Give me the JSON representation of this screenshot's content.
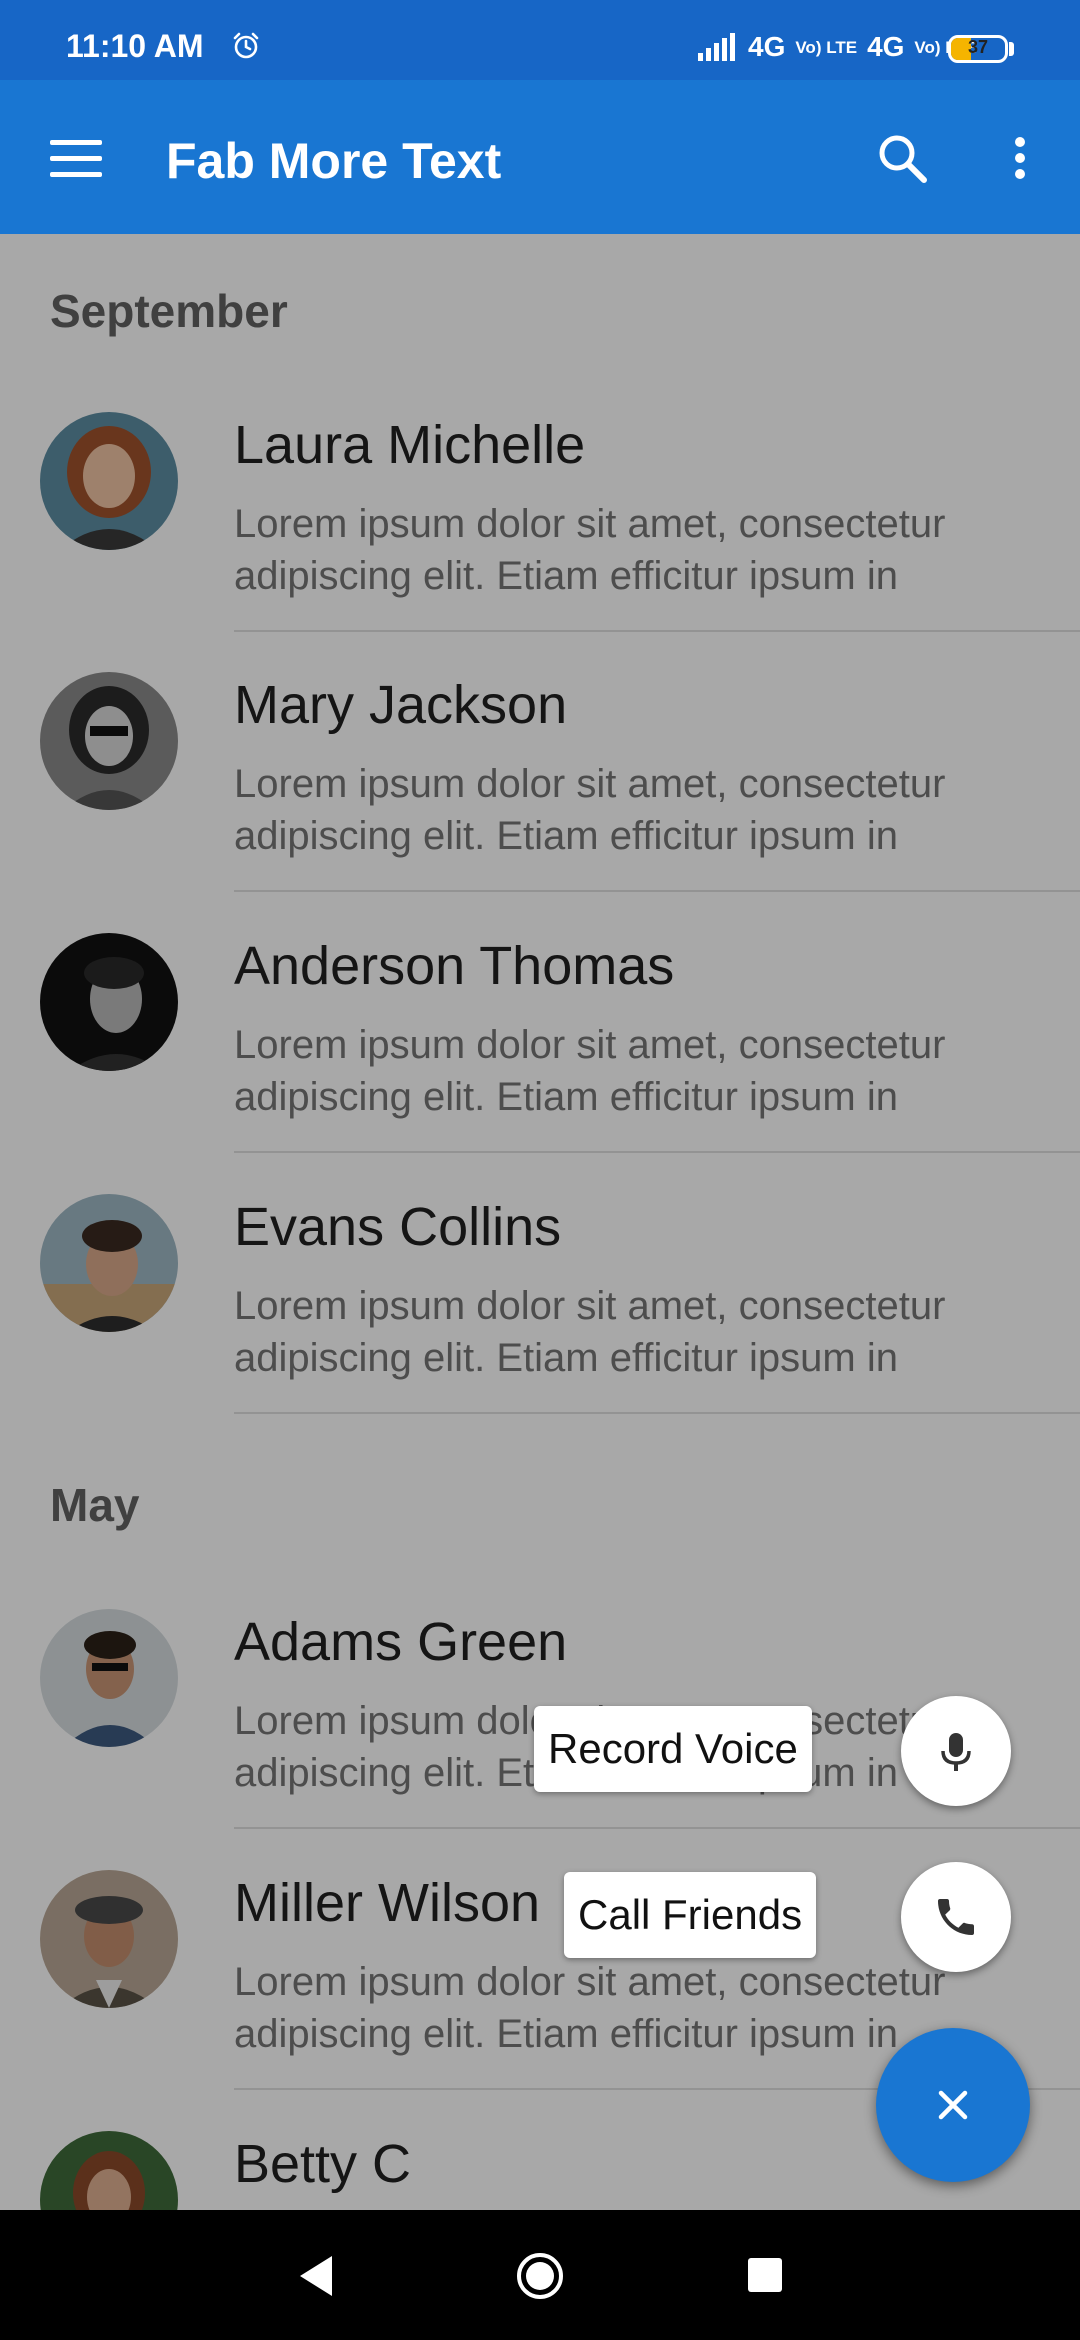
{
  "status_bar": {
    "time": "11:10 AM",
    "network": [
      "4G",
      "4G"
    ],
    "volte_label": "Vo) LTE",
    "battery_level": "37",
    "battery_fraction": 0.37
  },
  "app_bar": {
    "title": "Fab More Text",
    "icons": [
      "menu-icon",
      "search-icon",
      "more-vertical-icon"
    ]
  },
  "sections": [
    {
      "header": "September"
    },
    {
      "header": "May"
    }
  ],
  "contacts": [
    {
      "name": "Laura Michelle",
      "text_line1": "Lorem ipsum dolor sit amet, consectetur",
      "text_line2": "adipiscing elit. Etiam efficitur ipsum in"
    },
    {
      "name": "Mary Jackson",
      "text_line1": "Lorem ipsum dolor sit amet, consectetur",
      "text_line2": "adipiscing elit. Etiam efficitur ipsum in"
    },
    {
      "name": "Anderson Thomas",
      "text_line1": "Lorem ipsum dolor sit amet, consectetur",
      "text_line2": "adipiscing elit. Etiam efficitur ipsum in"
    },
    {
      "name": "Evans Collins",
      "text_line1": "Lorem ipsum dolor sit amet, consectetur",
      "text_line2": "adipiscing elit. Etiam efficitur ipsum in"
    },
    {
      "name": "Adams Green",
      "text_line1": "Lorem ipsum dolor sit amet, consectetur",
      "text_line2": "adipiscing elit. Etiam efficitur ipsum in"
    },
    {
      "name": "Miller Wilson",
      "text_line1": "Lorem ipsum dolor sit amet, consectetur",
      "text_line2": "adipiscing elit. Etiam efficitur ipsum in"
    },
    {
      "name": "Betty C",
      "text_line1": "",
      "text_line2": ""
    }
  ],
  "fab_menu": {
    "items": [
      {
        "label": "Record Voice",
        "icon": "mic-icon"
      },
      {
        "label": "Call Friends",
        "icon": "phone-icon"
      }
    ],
    "main_icon": "close-icon"
  },
  "colors": {
    "primary": "#1976d2",
    "status_bar": "#1766c6",
    "battery": "#f5b400"
  },
  "nav_bar": {
    "icons": [
      "back-icon",
      "home-icon",
      "recents-icon"
    ]
  }
}
